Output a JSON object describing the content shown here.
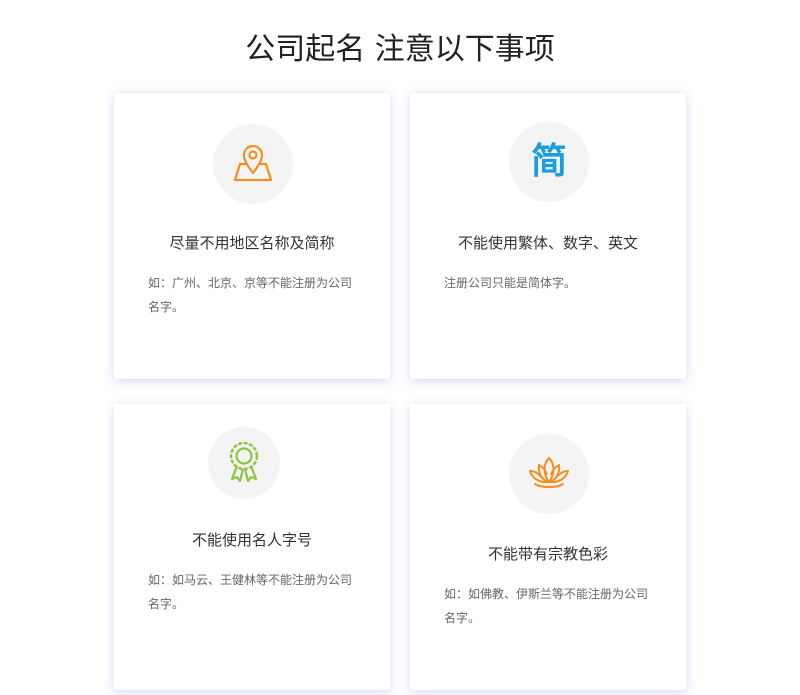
{
  "page": {
    "title": "公司起名 注意以下事项"
  },
  "cards": [
    {
      "icon": "map-pin-icon",
      "icon_color": "#f0901e",
      "title": "尽量不用地区名称及简称",
      "desc": "如：广州、北京、京等不能注册为公司名字。"
    },
    {
      "icon": "simplified-char-icon",
      "icon_color": "#1a9ee0",
      "icon_text": "简",
      "title": "不能使用繁体、数字、英文",
      "desc": "注册公司只能是简体字。"
    },
    {
      "icon": "award-ribbon-icon",
      "icon_color": "#8cc63f",
      "title": "不能使用名人字号",
      "desc": "如：如马云、王健林等不能注册为公司名字。"
    },
    {
      "icon": "lotus-icon",
      "icon_color": "#f0901e",
      "title": "不能带有宗教色彩",
      "desc": "如：如佛教、伊斯兰等不能注册为公司名字。"
    }
  ]
}
